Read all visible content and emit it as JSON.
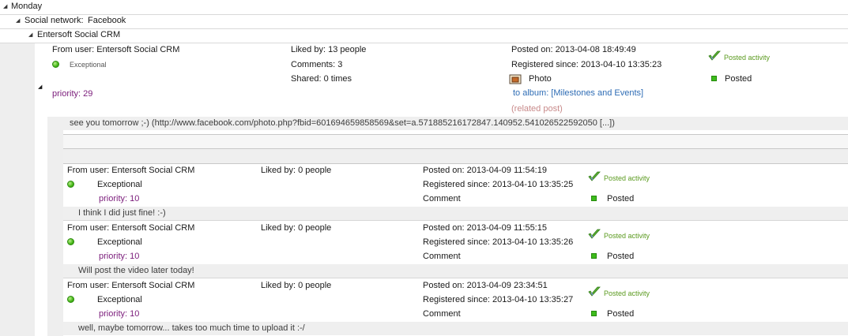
{
  "groups": {
    "day": "Monday",
    "network_label": "Social network:",
    "network_value": "Facebook",
    "account": "Entersoft Social CRM"
  },
  "parent": {
    "from_user": "From user: Entersoft Social CRM",
    "sentiment": "Exceptional",
    "priority": "priority: 29",
    "liked_by": "Liked by: 13 people",
    "comments": "Comments: 3",
    "shared": "Shared: 0 times",
    "posted_on": "Posted on: 2013-04-08 18:49:49",
    "registered": "Registered since: 2013-04-10 13:35:23",
    "post_type": "Photo",
    "album": "to album: [Milestones and Events]",
    "related": "(related post)",
    "activity": "Posted activity",
    "status": "Posted",
    "message": "see you tomorrow ;-) (http://www.facebook.com/photo.php?fbid=601694659858569&set=a.571885216172847.140952.541026522592050 [...])"
  },
  "comments": [
    {
      "from_user": "From user: Entersoft Social CRM",
      "sentiment": "Exceptional",
      "priority": "priority: 10",
      "liked_by": "Liked by: 0 people",
      "posted_on": "Posted on: 2013-04-09 11:54:19",
      "registered": "Registered since: 2013-04-10 13:35:25",
      "type": "Comment",
      "activity": "Posted activity",
      "status": "Posted",
      "message": "I think I did just fine! :-)"
    },
    {
      "from_user": "From user: Entersoft Social CRM",
      "sentiment": "Exceptional",
      "priority": "priority: 10",
      "liked_by": "Liked by: 0 people",
      "posted_on": "Posted on: 2013-04-09 11:55:15",
      "registered": "Registered since: 2013-04-10 13:35:26",
      "type": "Comment",
      "activity": "Posted activity",
      "status": "Posted",
      "message": "Will post the video later today!"
    },
    {
      "from_user": "From user: Entersoft Social CRM",
      "sentiment": "Exceptional",
      "priority": "priority: 10",
      "liked_by": "Liked by: 0 people",
      "posted_on": "Posted on: 2013-04-09 23:34:51",
      "registered": "Registered since: 2013-04-10 13:35:27",
      "type": "Comment",
      "activity": "Posted activity",
      "status": "Posted",
      "message": "well, maybe tomorrow... takes too much time to upload it :-/"
    }
  ]
}
